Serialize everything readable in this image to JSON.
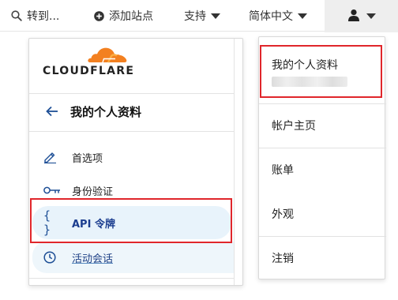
{
  "topbar": {
    "goto_label": "转到...",
    "add_site_label": "添加站点",
    "support_label": "支持",
    "language_label": "简体中文"
  },
  "panel": {
    "logo_text": "CLOUDFLARE",
    "title": "我的个人资料",
    "nav": [
      {
        "label": "首选项",
        "icon": "pencil-icon"
      },
      {
        "label": "身份验证",
        "icon": "key-icon"
      },
      {
        "label": "API 令牌",
        "icon": "curly-braces-icon",
        "glyph": "{ }"
      },
      {
        "label": "活动会话",
        "icon": "clock-icon"
      }
    ]
  },
  "menu": {
    "items": [
      {
        "label": "我的个人资料"
      },
      {
        "label": "帐户主页"
      },
      {
        "label": "账单"
      },
      {
        "label": "外观"
      },
      {
        "label": "注销"
      }
    ]
  },
  "colors": {
    "accent_blue": "#1e4f96",
    "highlight": "#e0262b",
    "active_bg": "#e8f3fb",
    "cloudflare_orange": "#f38020"
  }
}
